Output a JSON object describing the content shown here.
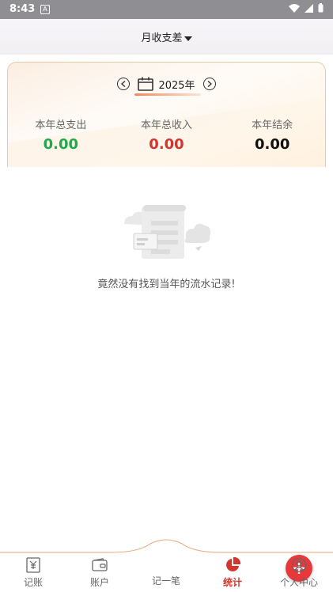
{
  "status_bar": {
    "time": "8:43",
    "notif_glyph": "A"
  },
  "header": {
    "title": "月收支差"
  },
  "summary": {
    "year": "2025年",
    "stats": [
      {
        "label": "本年总支出",
        "value": "0.00",
        "color": "#22a84a"
      },
      {
        "label": "本年总收入",
        "value": "0.00",
        "color": "#d2362f"
      },
      {
        "label": "本年结余",
        "value": "0.00",
        "color": "#111111"
      }
    ]
  },
  "empty": {
    "message": "竟然没有找到当年的流水记录!"
  },
  "tabbar": {
    "tabs": [
      {
        "label": "记账",
        "icon": "yen-receipt-icon"
      },
      {
        "label": "账户",
        "icon": "wallet-icon"
      },
      {
        "label": "记一笔",
        "icon": "plus-icon"
      },
      {
        "label": "统计",
        "icon": "pie-chart-icon",
        "active": true
      },
      {
        "label": "个人中心",
        "icon": "user-circle-icon"
      }
    ],
    "accent": "#d2362f"
  }
}
